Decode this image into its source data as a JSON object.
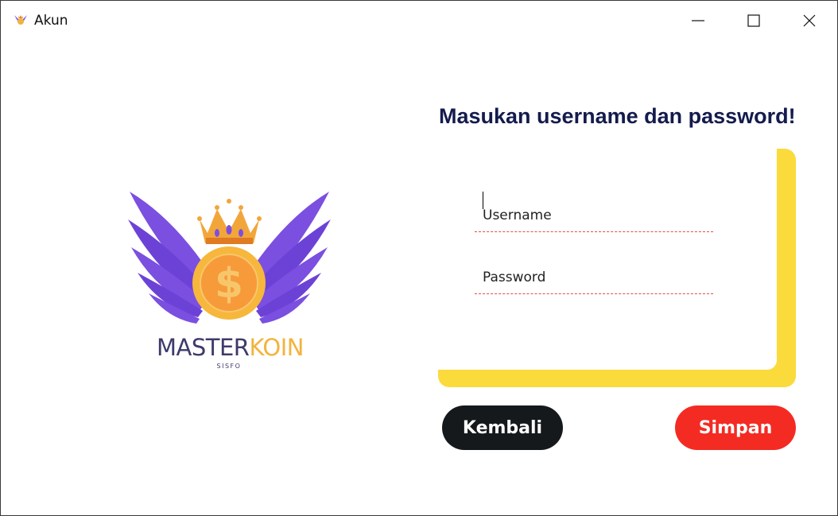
{
  "window": {
    "title": "Akun",
    "icon": "masterkoin-logo-icon",
    "controls": [
      "minimize-icon",
      "maximize-icon",
      "close-icon"
    ]
  },
  "logo": {
    "brand_left": "MASTER",
    "brand_right": "KOIN",
    "tagline": "SISFO"
  },
  "form": {
    "heading": "Masukan username dan password!",
    "username_placeholder": "Username",
    "username_value": "",
    "password_placeholder": "Password",
    "password_value": ""
  },
  "buttons": {
    "back_label": "Kembali",
    "save_label": "Simpan"
  },
  "colors": {
    "heading": "#141b4d",
    "panel_accent": "#fbda3b",
    "field_underline": "#e0503f",
    "back_button": "#15191c",
    "save_button": "#f42b23",
    "brand_purple": "#7b4fe0",
    "brand_gold": "#f2b33d"
  }
}
